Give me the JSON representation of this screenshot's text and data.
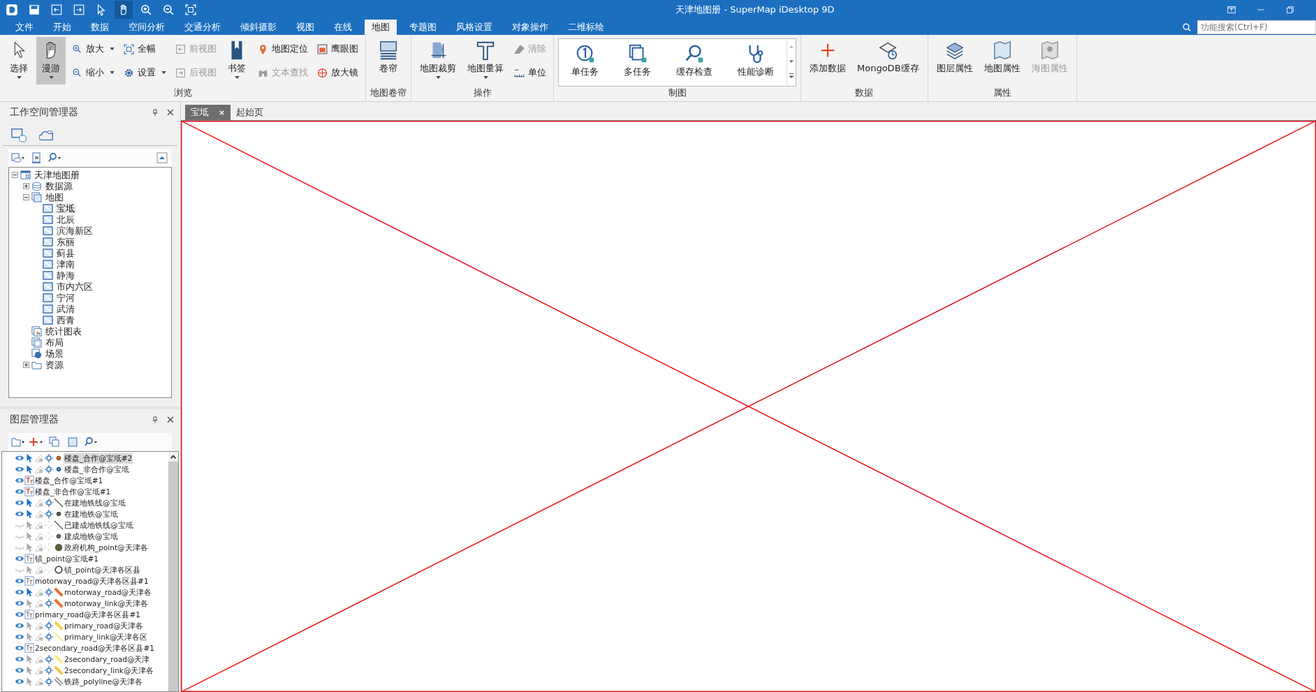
{
  "window": {
    "title": "天津地图册 - SuperMap iDesktop 9D"
  },
  "menu_tabs": [
    {
      "label": "文件",
      "selected": false
    },
    {
      "label": "开始",
      "selected": false
    },
    {
      "label": "数据",
      "selected": false
    },
    {
      "label": "空间分析",
      "selected": false
    },
    {
      "label": "交通分析",
      "selected": false
    },
    {
      "label": "倾斜摄影",
      "selected": false
    },
    {
      "label": "视图",
      "selected": false
    },
    {
      "label": "在线",
      "selected": false
    },
    {
      "label": "地图",
      "selected": true
    },
    {
      "label": "专题图",
      "selected": false
    },
    {
      "label": "风格设置",
      "selected": false
    },
    {
      "label": "对象操作",
      "selected": false
    },
    {
      "label": "二维标绘",
      "selected": false
    }
  ],
  "search": {
    "placeholder": "功能搜索(Ctrl+F)"
  },
  "ribbon_groups": [
    {
      "label": "浏览",
      "kind": "buttons",
      "items": [
        {
          "label": "选择",
          "kind": "large",
          "disabled": false,
          "selected": false,
          "dropdown": true
        },
        {
          "label": "漫游",
          "kind": "large",
          "disabled": false,
          "selected": true,
          "dropdown": true
        },
        {
          "label": "放大",
          "kind": "small",
          "disabled": false,
          "selected": false,
          "dropdown": true
        },
        {
          "label": "缩小",
          "kind": "small",
          "disabled": false,
          "selected": false,
          "dropdown": true
        },
        {
          "label": "全幅",
          "kind": "small",
          "disabled": false,
          "selected": false,
          "dropdown": false
        },
        {
          "label": "设置",
          "kind": "small",
          "disabled": false,
          "selected": false,
          "dropdown": true
        },
        {
          "label": "前视图",
          "kind": "small",
          "disabled": true,
          "selected": false,
          "dropdown": false
        },
        {
          "label": "后视图",
          "kind": "small",
          "disabled": true,
          "selected": false,
          "dropdown": false
        },
        {
          "label": "书签",
          "kind": "large",
          "disabled": false,
          "selected": false,
          "dropdown": true
        },
        {
          "label": "地图定位",
          "kind": "small",
          "disabled": false,
          "selected": false,
          "dropdown": false
        },
        {
          "label": "文本查找",
          "kind": "small",
          "disabled": true,
          "selected": false,
          "dropdown": false
        },
        {
          "label": "鹰眼图",
          "kind": "small",
          "disabled": false,
          "selected": false,
          "dropdown": false
        },
        {
          "label": "放大镜",
          "kind": "small",
          "disabled": false,
          "selected": false,
          "dropdown": false
        }
      ]
    },
    {
      "label": "地图卷帘",
      "kind": "buttons",
      "items": [
        {
          "label": "卷帘",
          "kind": "large",
          "disabled": false,
          "selected": false,
          "dropdown": false
        }
      ]
    },
    {
      "label": "操作",
      "kind": "buttons",
      "items": [
        {
          "label": "地图裁剪",
          "kind": "large",
          "disabled": false,
          "selected": false,
          "dropdown": true
        },
        {
          "label": "地图量算",
          "kind": "large",
          "disabled": false,
          "selected": false,
          "dropdown": true
        },
        {
          "label": "清除",
          "kind": "small",
          "disabled": true,
          "selected": false,
          "dropdown": false
        },
        {
          "label": "单位",
          "kind": "small",
          "disabled": false,
          "selected": false,
          "dropdown": false
        }
      ]
    },
    {
      "label": "制图",
      "kind": "gallery",
      "items": [
        {
          "label": "单任务",
          "disabled": false,
          "selected": false
        },
        {
          "label": "多任务",
          "disabled": false,
          "selected": false
        },
        {
          "label": "缓存检查",
          "disabled": false,
          "selected": false
        },
        {
          "label": "性能诊断",
          "disabled": false,
          "selected": false
        }
      ]
    },
    {
      "label": "数据",
      "kind": "buttons",
      "items": [
        {
          "label": "添加数据",
          "kind": "large",
          "disabled": false,
          "selected": false,
          "dropdown": false
        },
        {
          "label": "MongoDB缓存",
          "kind": "large",
          "disabled": false,
          "selected": false,
          "dropdown": false
        }
      ]
    },
    {
      "label": "属性",
      "kind": "buttons",
      "items": [
        {
          "label": "图层属性",
          "kind": "large",
          "disabled": false,
          "selected": false,
          "dropdown": false
        },
        {
          "label": "地图属性",
          "kind": "large",
          "disabled": false,
          "selected": false,
          "dropdown": false
        },
        {
          "label": "海图属性",
          "kind": "large",
          "disabled": true,
          "selected": false,
          "dropdown": false
        }
      ]
    }
  ],
  "workspace_manager": {
    "title": "工作空间管理器",
    "tree": [
      {
        "label": "天津地图册",
        "kind": "workspace",
        "selected": false,
        "expanded": true,
        "children": [
          {
            "label": "数据源",
            "kind": "datasource",
            "selected": false,
            "expanded": false
          },
          {
            "label": "地图",
            "kind": "maps",
            "selected": false,
            "expanded": true,
            "children": [
              {
                "label": "宝坻",
                "kind": "map",
                "selected": true
              },
              {
                "label": "北辰",
                "kind": "map",
                "selected": false
              },
              {
                "label": "滨海新区",
                "kind": "map",
                "selected": false
              },
              {
                "label": "东丽",
                "kind": "map",
                "selected": false
              },
              {
                "label": "蓟县",
                "kind": "map",
                "selected": false
              },
              {
                "label": "津南",
                "kind": "map",
                "selected": false
              },
              {
                "label": "静海",
                "kind": "map",
                "selected": false
              },
              {
                "label": "市内六区",
                "kind": "map",
                "selected": false
              },
              {
                "label": "宁河",
                "kind": "map",
                "selected": false
              },
              {
                "label": "武清",
                "kind": "map",
                "selected": false
              },
              {
                "label": "西青",
                "kind": "map",
                "selected": false
              }
            ]
          },
          {
            "label": "统计图表",
            "kind": "chart",
            "selected": false
          },
          {
            "label": "布局",
            "kind": "layout",
            "selected": false
          },
          {
            "label": "场景",
            "kind": "scene",
            "selected": false
          },
          {
            "label": "资源",
            "kind": "resources",
            "selected": false,
            "expanded": false
          }
        ]
      }
    ]
  },
  "layer_manager": {
    "title": "图层管理器",
    "layers": [
      {
        "name": "楼盘_合作@宝坻#2",
        "kind": "layer",
        "visible": true,
        "selectable": true,
        "selected": true,
        "symbol": {
          "kind": "dot",
          "color": "#e8620c"
        }
      },
      {
        "name": "楼盘_非合作@宝坻",
        "kind": "layer",
        "visible": true,
        "selectable": true,
        "selected": false,
        "symbol": {
          "kind": "dot",
          "color": "#1a8fe8"
        }
      },
      {
        "name": "楼盘_合作@宝坻#1",
        "kind": "label_theme",
        "visible": true,
        "selected": false
      },
      {
        "name": "楼盘_非合作@宝坻#1",
        "kind": "label_theme",
        "visible": true,
        "selected": false
      },
      {
        "name": "在建地铁线@宝坻",
        "kind": "layer",
        "visible": true,
        "selectable": true,
        "selected": false,
        "symbol": {
          "kind": "line",
          "color": "#333333"
        }
      },
      {
        "name": "在建地铁@宝坻",
        "kind": "layer",
        "visible": true,
        "selectable": true,
        "selected": false,
        "symbol": {
          "kind": "dot",
          "color": "#55604a"
        }
      },
      {
        "name": "已建成地铁线@宝坻",
        "kind": "layer",
        "visible": false,
        "selectable": false,
        "selected": false,
        "symbol": {
          "kind": "line",
          "color": "#333333"
        }
      },
      {
        "name": "建成地铁@宝坻",
        "kind": "layer",
        "visible": false,
        "selectable": false,
        "selected": false,
        "symbol": {
          "kind": "dot",
          "color": "#706068"
        }
      },
      {
        "name": "政府机构_point@天津各",
        "kind": "layer",
        "visible": false,
        "selectable": false,
        "selected": false,
        "symbol": {
          "kind": "bigdot",
          "color": "#5a5e40"
        }
      },
      {
        "name": "镇_point@宝坻#1",
        "kind": "theme",
        "visible": true,
        "selected": false
      },
      {
        "name": "镇_point@天津各区县",
        "kind": "layer",
        "visible": false,
        "selectable": false,
        "selected": false,
        "symbol": {
          "kind": "circle",
          "color": "#444444"
        }
      },
      {
        "name": "motorway_road@天津各区县#1",
        "kind": "theme",
        "visible": true,
        "selected": false
      },
      {
        "name": "motorway_road@天津各",
        "kind": "layer",
        "visible": true,
        "selectable": true,
        "selected": false,
        "symbol": {
          "kind": "band",
          "color": "#f07030"
        }
      },
      {
        "name": "motorway_link@天津各",
        "kind": "layer",
        "visible": true,
        "selectable": false,
        "selected": false,
        "symbol": {
          "kind": "band",
          "color": "#f07030"
        }
      },
      {
        "name": "primary_road@天津各区县#1",
        "kind": "theme",
        "visible": true,
        "selected": false
      },
      {
        "name": "primary_road@天津各",
        "kind": "layer",
        "visible": true,
        "selectable": false,
        "selected": false,
        "symbol": {
          "kind": "band",
          "color": "#f5d050"
        }
      },
      {
        "name": "primary_link@天津各区",
        "kind": "layer",
        "visible": true,
        "selectable": false,
        "selected": false,
        "symbol": {
          "kind": "line",
          "color": "#f0e020"
        }
      },
      {
        "name": "2secondary_road@天津各区县#1",
        "kind": "theme",
        "visible": true,
        "selected": false
      },
      {
        "name": "2secondary_road@天津",
        "kind": "layer",
        "visible": true,
        "selectable": false,
        "selected": false,
        "symbol": {
          "kind": "band",
          "color": "#f8f088"
        }
      },
      {
        "name": "2secondary_link@天津各",
        "kind": "layer",
        "visible": true,
        "selectable": false,
        "selected": false,
        "symbol": {
          "kind": "band",
          "color": "#f0c850"
        }
      },
      {
        "name": "铁路_polyline@天津各",
        "kind": "layer",
        "visible": true,
        "selectable": false,
        "selected": false,
        "symbol": {
          "kind": "rail",
          "color": "#888888"
        }
      }
    ]
  },
  "document_tabs": [
    {
      "label": "宝坻",
      "selected": true,
      "closable": true
    },
    {
      "label": "起始页",
      "selected": false,
      "closable": false
    }
  ]
}
